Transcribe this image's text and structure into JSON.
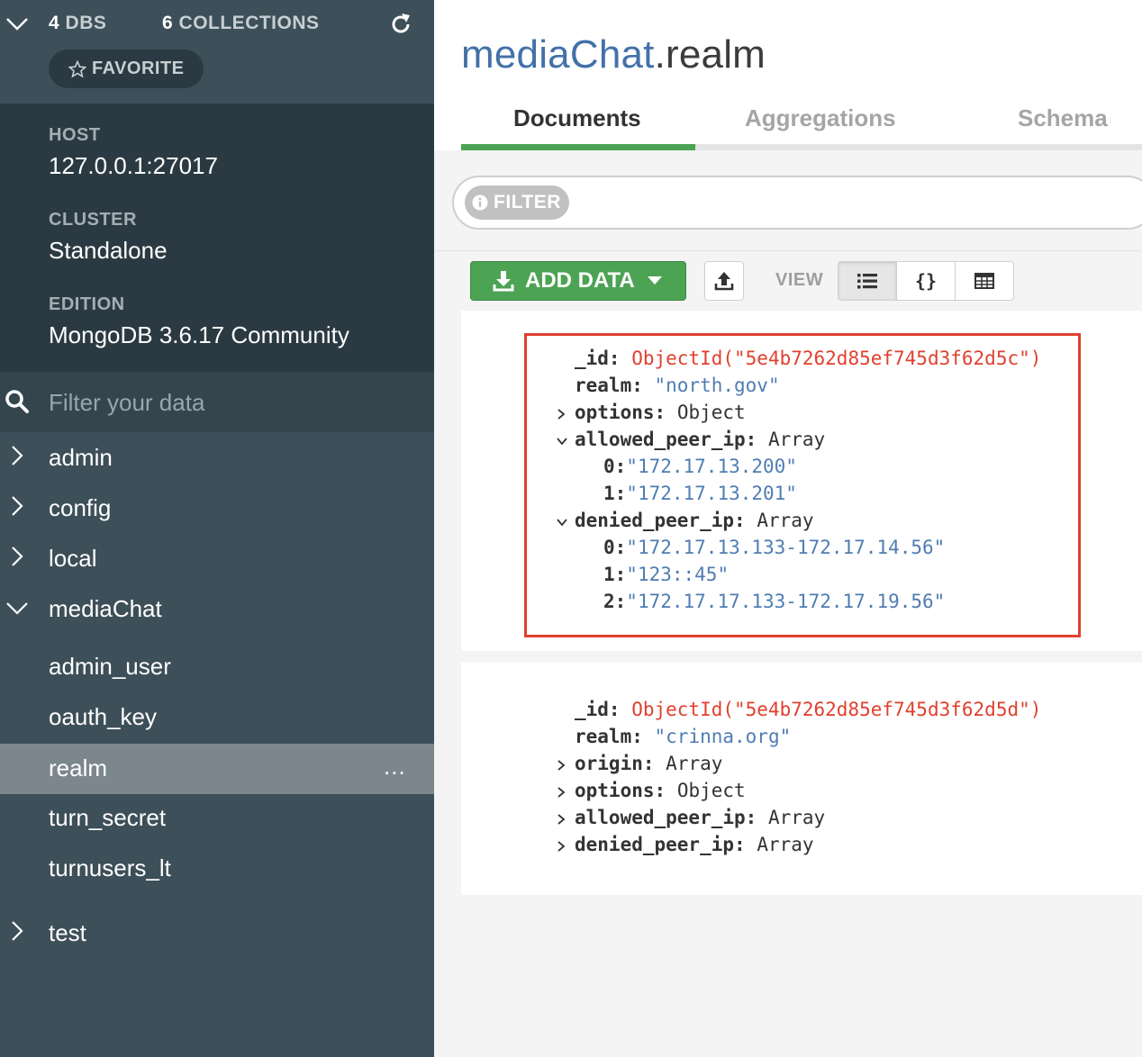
{
  "sidebar": {
    "dbs_count": "4",
    "dbs_label": "DBS",
    "collections_count": "6",
    "collections_label": "COLLECTIONS",
    "favorite_label": "FAVORITE",
    "host_label": "HOST",
    "host_value": "127.0.0.1:27017",
    "cluster_label": "CLUSTER",
    "cluster_value": "Standalone",
    "edition_label": "EDITION",
    "edition_value": "MongoDB 3.6.17 Community",
    "filter_placeholder": "Filter your data",
    "databases": [
      {
        "name": "admin",
        "expanded": false
      },
      {
        "name": "config",
        "expanded": false
      },
      {
        "name": "local",
        "expanded": false
      },
      {
        "name": "mediaChat",
        "expanded": true
      },
      {
        "name": "test",
        "expanded": false
      }
    ],
    "collections": [
      {
        "name": "admin_user"
      },
      {
        "name": "oauth_key"
      },
      {
        "name": "realm",
        "selected": true
      },
      {
        "name": "turn_secret"
      },
      {
        "name": "turnusers_lt"
      }
    ],
    "more_label": "..."
  },
  "main": {
    "title_db": "mediaChat",
    "title_coll": ".realm",
    "tabs": [
      {
        "label": "Documents",
        "active": true
      },
      {
        "label": "Aggregations",
        "active": false
      },
      {
        "label": "Schema",
        "active": false
      }
    ],
    "filter_chip": "FILTER",
    "add_data_label": "ADD DATA",
    "view_label": "VIEW",
    "view_modes": [
      "list-view-icon",
      "json-view-icon",
      "table-view-icon"
    ],
    "braces": "{}"
  },
  "documents": [
    {
      "id_key": "_id:",
      "id_value": "ObjectId(\"5e4b7262d85ef745d3f62d5c\")",
      "realm_key": "realm:",
      "realm_value": "\"north.gov\"",
      "options_key": "options:",
      "options_type": "Object",
      "allowed_key": "allowed_peer_ip:",
      "allowed_type": "Array",
      "allowed": [
        {
          "idx": "0:",
          "val": "\"172.17.13.200\""
        },
        {
          "idx": "1:",
          "val": "\"172.17.13.201\""
        }
      ],
      "denied_key": "denied_peer_ip:",
      "denied_type": "Array",
      "denied": [
        {
          "idx": "0:",
          "val": "\"172.17.13.133-172.17.14.56\""
        },
        {
          "idx": "1:",
          "val": "\"123::45\""
        },
        {
          "idx": "2:",
          "val": "\"172.17.17.133-172.17.19.56\""
        }
      ]
    },
    {
      "id_key": "_id:",
      "id_value": "ObjectId(\"5e4b7262d85ef745d3f62d5d\")",
      "realm_key": "realm:",
      "realm_value": "\"crinna.org\"",
      "origin_key": "origin:",
      "origin_type": "Array",
      "options_key": "options:",
      "options_type": "Object",
      "allowed_key": "allowed_peer_ip:",
      "allowed_type": "Array",
      "denied_key": "denied_peer_ip:",
      "denied_type": "Array"
    }
  ],
  "colors": {
    "sidebar_bg": "#3d4f58",
    "sidebar_info_bg": "#2b3a42",
    "accent_green": "#4ca354",
    "objectid_red": "#e0402e",
    "string_blue": "#4f7db3",
    "highlight_border": "#e0402e"
  }
}
